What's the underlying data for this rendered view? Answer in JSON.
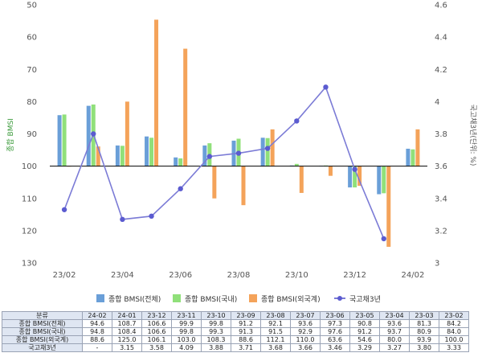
{
  "chart_data": {
    "type": "bar",
    "categories": [
      "24-02",
      "24-01",
      "23-12",
      "23-11",
      "23-10",
      "23-09",
      "23-08",
      "23-07",
      "23-06",
      "23-05",
      "23-04",
      "23-03",
      "23-02"
    ],
    "x_tick_labels": [
      "24/02",
      "23/12",
      "23/10",
      "23/08",
      "23/06",
      "23/04",
      "23/02"
    ],
    "series": [
      {
        "name": "종합 BMSI(전체)",
        "axis": "left",
        "color": "#6a9fd8",
        "values": [
          94.6,
          108.7,
          106.6,
          99.9,
          99.8,
          91.2,
          92.1,
          93.6,
          97.3,
          90.8,
          93.6,
          81.3,
          84.2
        ]
      },
      {
        "name": "종합 BMSI(국내)",
        "axis": "left",
        "color": "#90e07a",
        "values": [
          94.8,
          108.4,
          106.6,
          99.8,
          99.3,
          91.3,
          91.5,
          92.9,
          97.6,
          91.2,
          93.7,
          80.9,
          84.0
        ]
      },
      {
        "name": "종합 BMSI(외국계)",
        "axis": "left",
        "color": "#f4a35a",
        "values": [
          88.6,
          125.0,
          106.1,
          103.0,
          108.3,
          88.6,
          112.1,
          110.0,
          63.6,
          54.6,
          80.0,
          93.9,
          100.0
        ]
      },
      {
        "name": "국고채3년",
        "type": "line",
        "axis": "right",
        "color": "#7b7bd6",
        "values": [
          null,
          3.15,
          3.58,
          4.09,
          3.88,
          3.71,
          3.68,
          3.66,
          3.46,
          3.29,
          3.27,
          3.8,
          3.33
        ]
      }
    ],
    "left_axis": {
      "label": "종합 BMSI",
      "min": 50,
      "max": 130,
      "inverted": true,
      "baseline": 100,
      "ticks": [
        50,
        60,
        70,
        80,
        90,
        100,
        110,
        120,
        130
      ]
    },
    "right_axis": {
      "label": "국고채3년(단위: %)",
      "min": 3.0,
      "max": 4.6,
      "ticks": [
        "4.6",
        "4.4",
        "4.2",
        "4",
        "3.8",
        "3.6",
        "3.4",
        "3.2",
        "3"
      ]
    },
    "legend_position": "bottom",
    "grid": false
  },
  "table": {
    "header_label": "분류",
    "rows": [
      {
        "label": "종합 BMSI(전체)",
        "cells": [
          "94.6",
          "108.7",
          "106.6",
          "99.9",
          "99.8",
          "91.2",
          "92.1",
          "93.6",
          "97.3",
          "90.8",
          "93.6",
          "81.3",
          "84.2"
        ]
      },
      {
        "label": "종합 BMSI(국내)",
        "cells": [
          "94.8",
          "108.4",
          "106.6",
          "99.8",
          "99.3",
          "91.3",
          "91.5",
          "92.9",
          "97.6",
          "91.2",
          "93.7",
          "80.9",
          "84.0"
        ]
      },
      {
        "label": "종합 BMSI(외국계)",
        "cells": [
          "88.6",
          "125.0",
          "106.1",
          "103.0",
          "108.3",
          "88.6",
          "112.1",
          "110.0",
          "63.6",
          "54.6",
          "80.0",
          "93.9",
          "100.0"
        ]
      },
      {
        "label": "국고채3년",
        "cells": [
          "-",
          "3.15",
          "3.58",
          "4.09",
          "3.88",
          "3.71",
          "3.68",
          "3.66",
          "3.46",
          "3.29",
          "3.27",
          "3.80",
          "3.33"
        ]
      }
    ]
  }
}
